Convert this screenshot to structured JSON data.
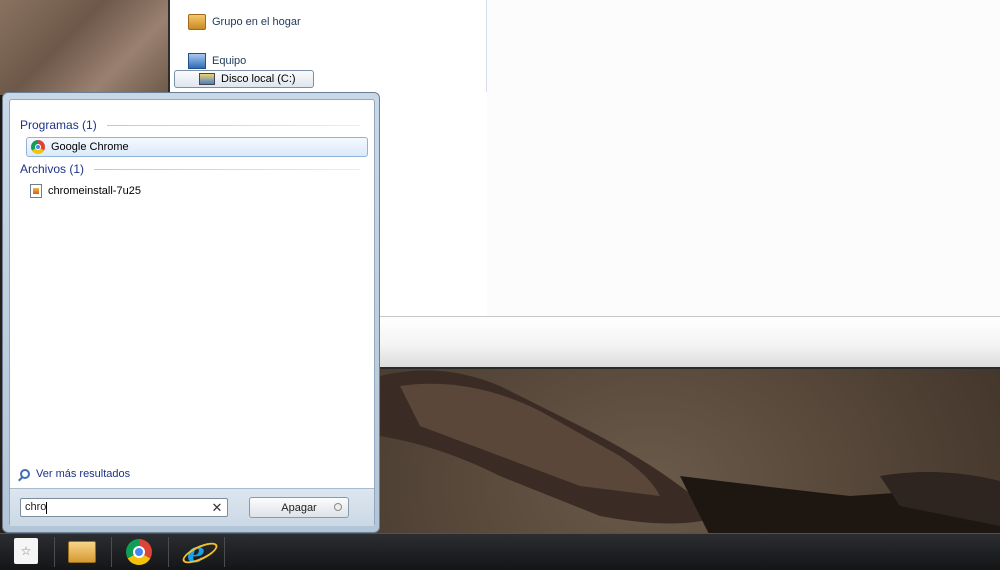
{
  "explorer": {
    "nav_items": [
      "Grupo en el hogar",
      "Equipo"
    ],
    "selected_item": "Disco local (C:)"
  },
  "startmenu": {
    "sections": [
      {
        "title": "Programas (1)",
        "results": [
          "Google Chrome"
        ]
      },
      {
        "title": "Archivos (1)",
        "results": [
          "chromeinstall-7u25"
        ]
      }
    ],
    "more_results": "Ver más resultados",
    "search": {
      "value": "chro"
    },
    "shutdown_label": "Apagar"
  },
  "taskbar": {
    "apps": [
      "file-explorer",
      "google-chrome",
      "internet-explorer"
    ]
  }
}
